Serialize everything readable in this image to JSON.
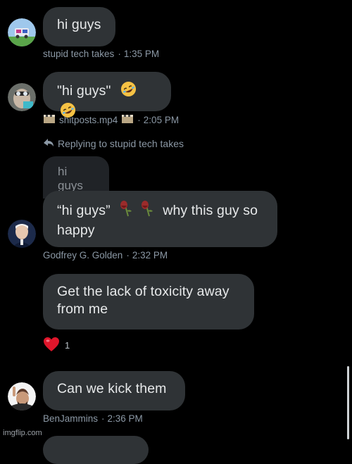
{
  "messages": [
    {
      "text": "hi guys",
      "author": "stupid tech takes",
      "time": "1:35 PM"
    },
    {
      "text": "\"hi guys\"",
      "author": "shitposts.mp4",
      "time": "2:05 PM",
      "emoji": "rolling-on-floor-laughing-emoji"
    },
    {
      "reply_label": "Replying to stupid tech takes",
      "quoted_text": "hi guys",
      "text_part1": "“hi guys”",
      "text_part2": "why this guy so",
      "text_line2": "happy",
      "author": "Godfrey G. Golden",
      "time": "2:32 PM",
      "emoji": "wilted-rose-emoji"
    },
    {
      "text_line1": "Get the lack of toxicity away",
      "text_line2": "from me",
      "reaction_emoji": "red-heart-emoji",
      "reaction_count": "1"
    },
    {
      "text": "Can we kick them",
      "author": "BenJammins",
      "time": "2:36 PM"
    }
  ],
  "meta_separator": "·",
  "watermark": "imgflip.com",
  "colors": {
    "background": "#000000",
    "bubble": "#2f3336",
    "quoted_bubble": "#202327",
    "text": "#e7e9ea",
    "meta_text": "#8b98a5"
  }
}
